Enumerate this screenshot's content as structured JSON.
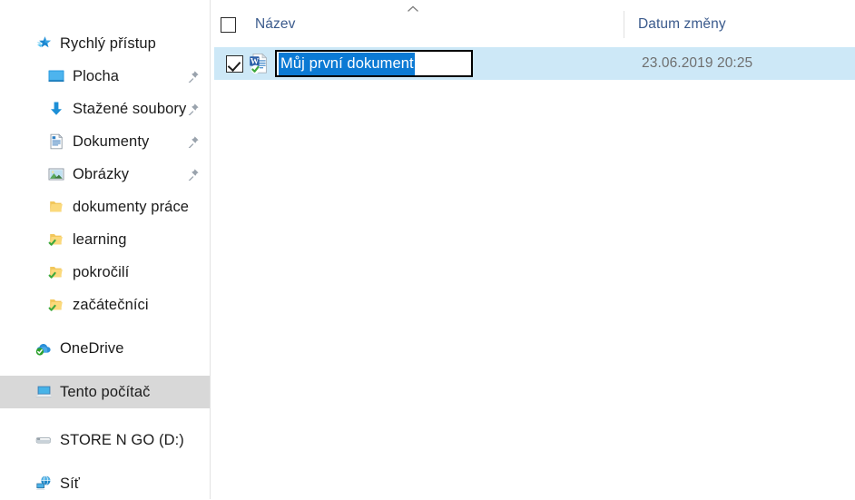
{
  "nav_pane": {
    "quick_access": {
      "label": "Rychlý přístup",
      "icon": "star-icon"
    },
    "quick_items": [
      {
        "label": "Plocha",
        "icon": "desktop-icon",
        "pinned": true
      },
      {
        "label": "Stažené soubory",
        "icon": "downloads-icon",
        "pinned": true
      },
      {
        "label": "Dokumenty",
        "icon": "documents-icon",
        "pinned": true
      },
      {
        "label": "Obrázky",
        "icon": "pictures-icon",
        "pinned": true
      },
      {
        "label": "dokumenty práce",
        "icon": "folder-icon",
        "pinned": false
      },
      {
        "label": "learning",
        "icon": "folder-synced-icon",
        "pinned": false
      },
      {
        "label": "pokročilí",
        "icon": "folder-synced-icon",
        "pinned": false
      },
      {
        "label": "začátečníci",
        "icon": "folder-synced-icon",
        "pinned": false
      }
    ],
    "onedrive": {
      "label": "OneDrive",
      "icon": "onedrive-cloud-icon"
    },
    "this_pc": {
      "label": "Tento počítač",
      "icon": "computer-icon",
      "selected": true
    },
    "drive": {
      "label": "STORE N GO (D:)",
      "icon": "usb-drive-icon"
    },
    "network": {
      "label": "Síť",
      "icon": "network-icon"
    }
  },
  "file_list": {
    "columns": {
      "name": {
        "label": "Název",
        "sorted": "ascending"
      },
      "date": {
        "label": "Datum změny",
        "sorted": "none"
      }
    },
    "select_all_checked": false,
    "rows": [
      {
        "name_value": "Můj první dokument",
        "date_modified": "23.06.2019 20:25",
        "checked": true,
        "selected": true,
        "renaming": true,
        "icon": "word-document-synced-icon"
      }
    ]
  },
  "colors": {
    "selection_row": "#cde8f7",
    "text_selection": "#0b7ad4",
    "nav_selected": "#d8d8d8",
    "header_text": "#3a5a8c",
    "date_text": "#6f6f6f"
  }
}
